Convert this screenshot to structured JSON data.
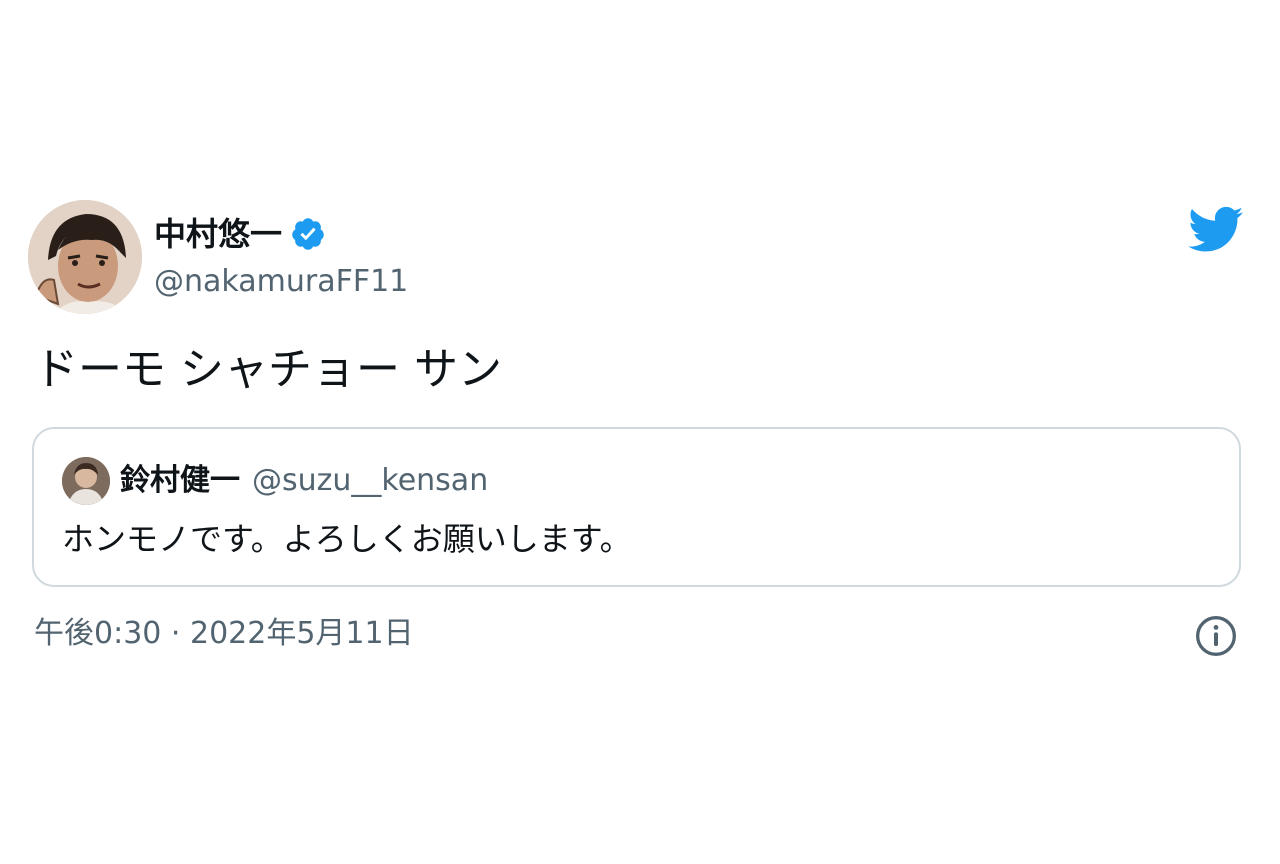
{
  "tweet": {
    "author": {
      "display_name": "中村悠一",
      "handle": "@nakamuraFF11",
      "avatar_icon": "avatar-illustration",
      "verified_icon": "verified-badge-icon"
    },
    "text": "ドーモ シャチョー サン",
    "quoted_tweet": {
      "display_name": "鈴村健一",
      "handle": "@suzu__kensan",
      "avatar_icon": "avatar-photo",
      "text": "ホンモノです。よろしくお願いします。"
    },
    "timestamp": "午後0:30 · 2022年5月11日",
    "brand_icon": "twitter-bird-icon",
    "info_icon": "info-icon"
  },
  "colors": {
    "twitter_blue": "#1d9bf0",
    "text_primary": "#0f1419",
    "text_secondary": "#536471",
    "border": "#cfd9de"
  }
}
